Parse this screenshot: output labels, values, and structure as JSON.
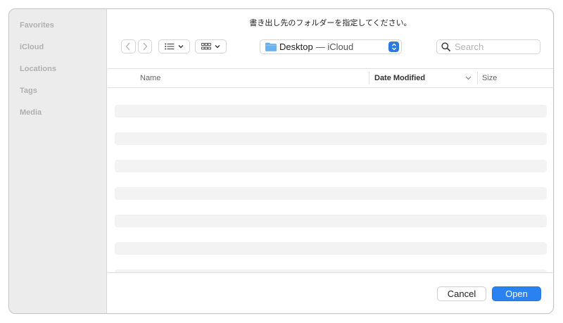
{
  "dialog": {
    "title": "書き出し先のフォルダーを指定してください。"
  },
  "sidebar": {
    "items": [
      {
        "label": "Favorites"
      },
      {
        "label": "iCloud"
      },
      {
        "label": "Locations"
      },
      {
        "label": "Tags"
      },
      {
        "label": "Media"
      }
    ]
  },
  "toolbar": {
    "back_icon": "chevron-left-icon",
    "forward_icon": "chevron-right-icon",
    "list_view_icon": "list-icon",
    "grid_view_icon": "grid-icon",
    "location": {
      "folder_icon": "folder-icon",
      "name": "Desktop",
      "sub": "— iCloud"
    },
    "search": {
      "placeholder": "Search",
      "value": ""
    }
  },
  "columns": {
    "name": "Name",
    "date_modified": "Date Modified",
    "size": "Size"
  },
  "footer": {
    "cancel_label": "Cancel",
    "open_label": "Open"
  },
  "colors": {
    "accent": "#2a82f0",
    "sidebar_bg": "#ececec",
    "placeholder_row": "#f3f3f3"
  }
}
